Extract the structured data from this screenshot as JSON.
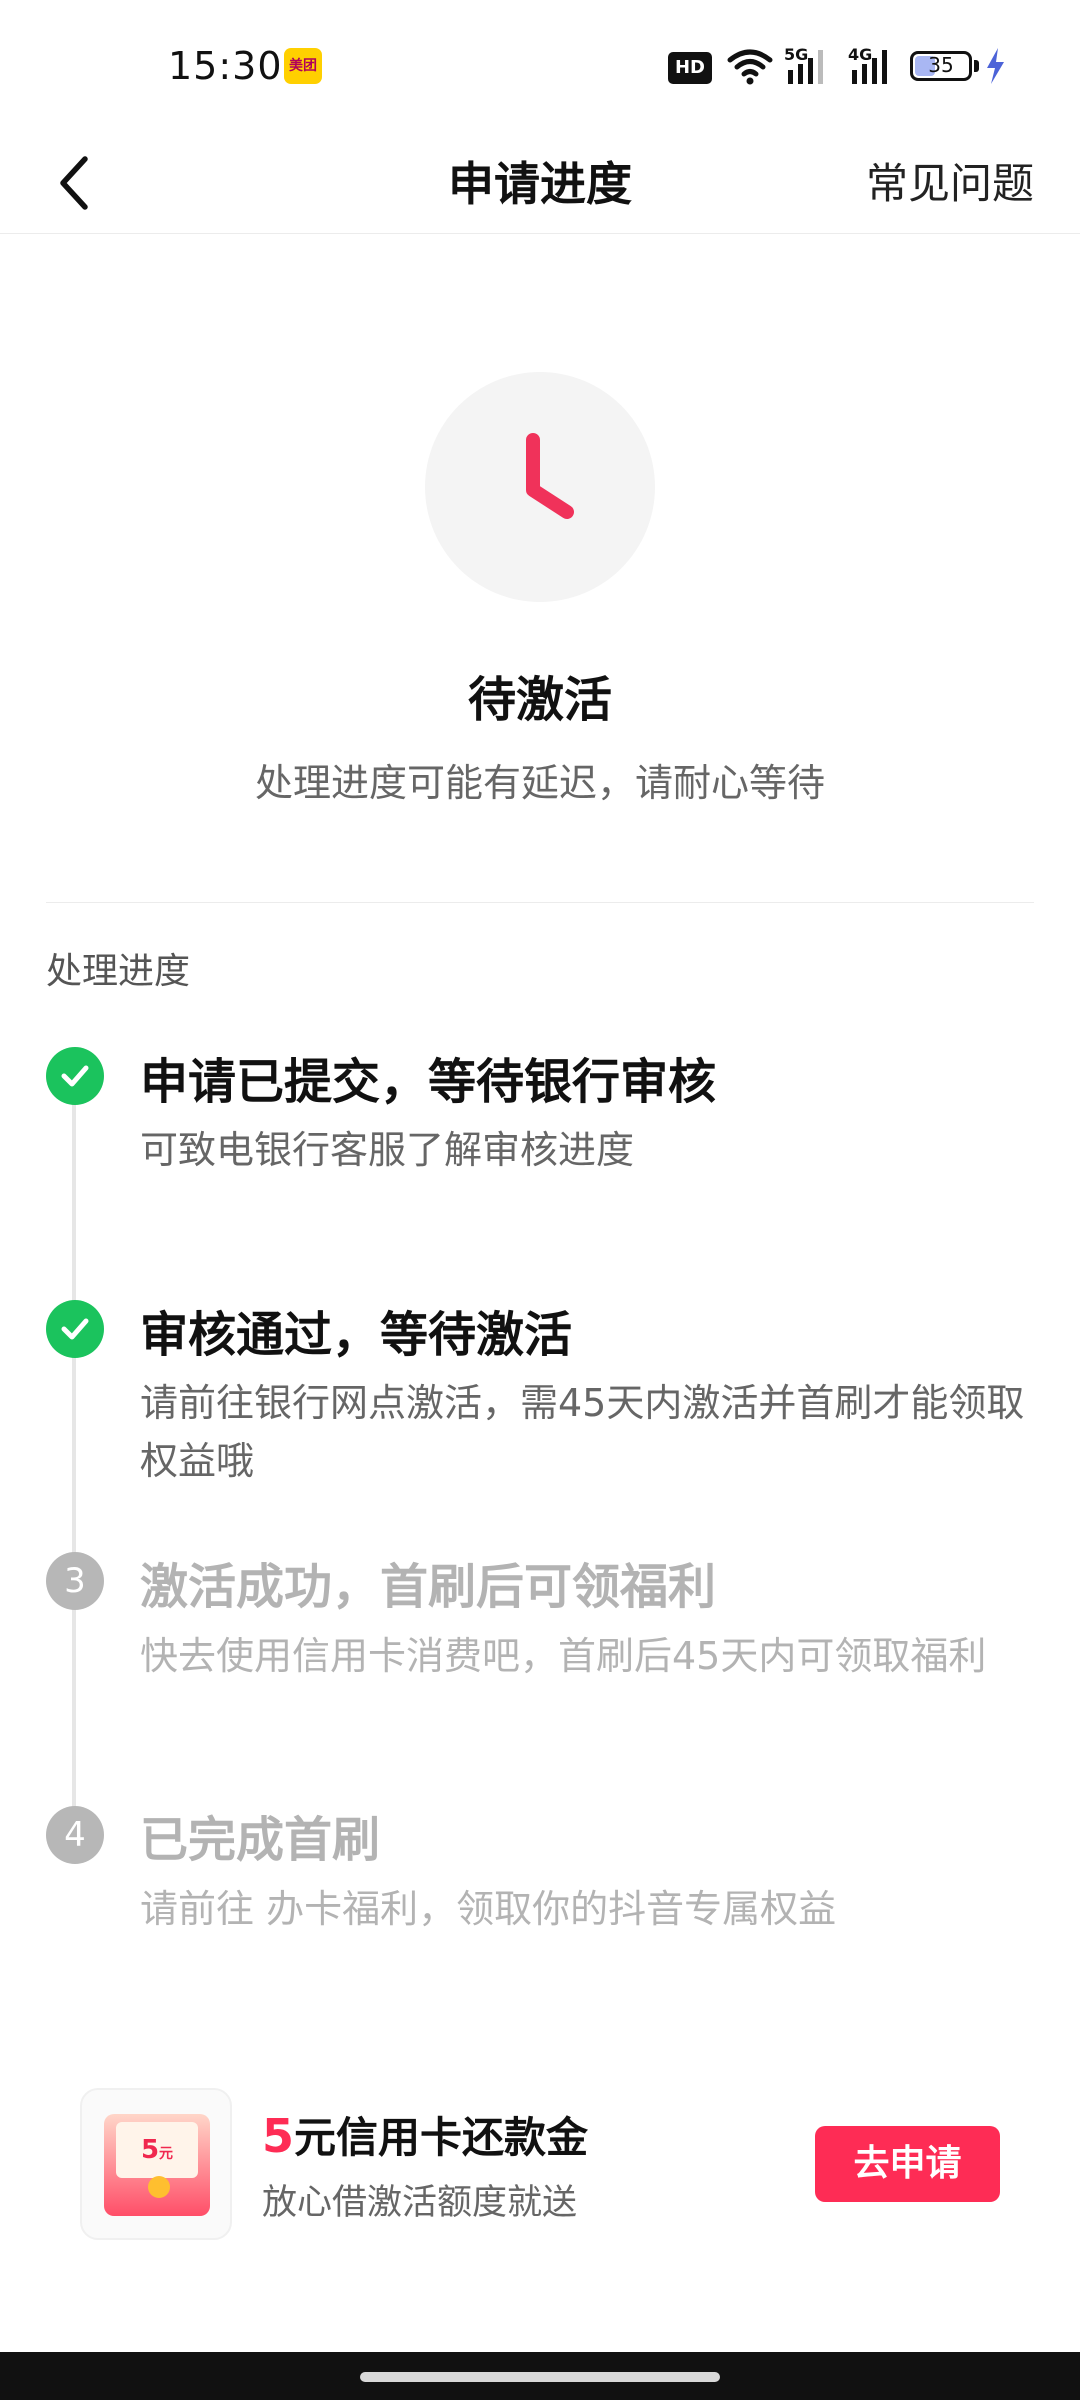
{
  "status_bar": {
    "time": "15:30",
    "app_badge": "美团",
    "hd": "HD",
    "net_5g": "5G",
    "net_4g": "4G",
    "battery": "35",
    "battery_level": 0.35
  },
  "nav": {
    "back_icon": "chevron-left-icon",
    "title": "申请进度",
    "faq_label": "常见问题"
  },
  "status": {
    "icon": "clock-icon",
    "title": "待激活",
    "subtitle": "处理进度可能有延迟，请耐心等待"
  },
  "progress": {
    "section_label": "处理进度",
    "steps": [
      {
        "state": "done",
        "title": "申请已提交，等待银行审核",
        "desc": "可致电银行客服了解审核进度"
      },
      {
        "state": "done",
        "title": "审核通过，等待激活",
        "desc": "请前往银行网点激活，需45天内激活并首刷才能领取权益哦"
      },
      {
        "state": "pending",
        "number": "3",
        "title": "激活成功，首刷后可领福利",
        "desc": "快去使用信用卡消费吧，首刷后45天内可领取福利"
      },
      {
        "state": "pending",
        "number": "4",
        "title": "已完成首刷",
        "desc": "请前往 办卡福利，领取你的抖音专属权益"
      }
    ]
  },
  "promo": {
    "thumb_amount": "5",
    "thumb_unit": "元",
    "amount": "5",
    "title_rest": "元信用卡还款金",
    "subtitle": "放心借激活额度就送",
    "button_label": "去申请"
  },
  "colors": {
    "accent": "#fe2c55",
    "done": "#1bc35d",
    "pending": "#b7b7b7"
  }
}
